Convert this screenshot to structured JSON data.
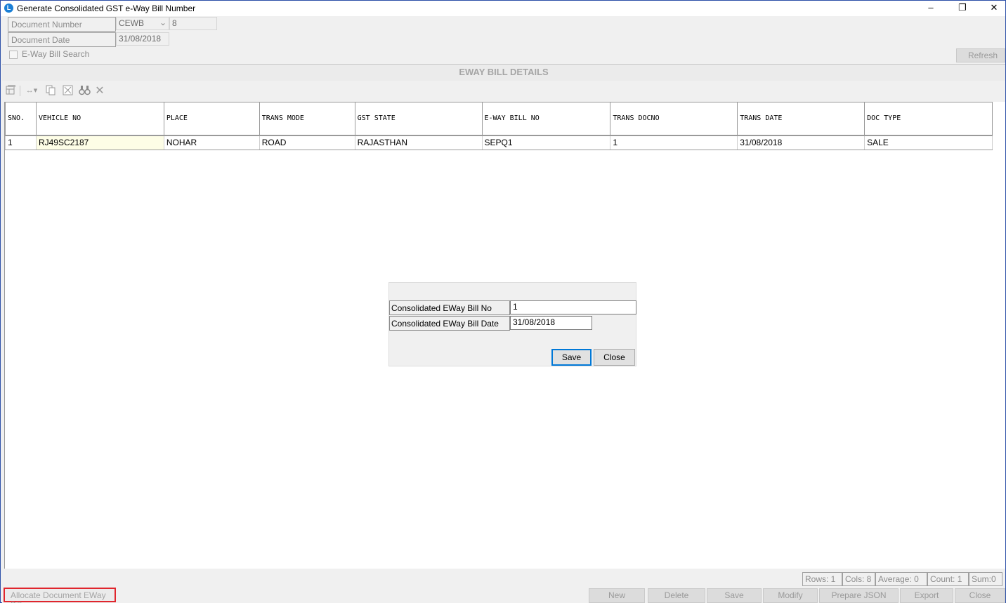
{
  "window": {
    "title": "Generate Consolidated GST e-Way Bill Number",
    "minimize_glyph": "–",
    "restore_glyph": "❐",
    "close_glyph": "✕"
  },
  "header": {
    "doc_number_label": "Document Number",
    "doc_series": "CEWB",
    "doc_number": "8",
    "doc_date_label": "Document Date",
    "doc_date": "31/08/2018",
    "eway_search_label": "E-Way Bill Search",
    "refresh_label": "Refresh"
  },
  "section": {
    "title": "EWAY BILL DETAILS"
  },
  "toolbar": {
    "icons": [
      "grid-settings-icon",
      "column-resize-icon",
      "copy-icon",
      "export-excel-icon",
      "find-icon",
      "clear-icon"
    ]
  },
  "grid": {
    "columns": [
      "SNO.",
      "VEHICLE NO",
      "PLACE",
      "TRANS MODE",
      "GST STATE",
      "E-WAY BILL NO",
      "TRANS DOCNO",
      "TRANS DATE",
      "DOC TYPE"
    ],
    "rows": [
      [
        "1",
        "RJ49SC2187",
        "NOHAR",
        "ROAD",
        "RAJASTHAN",
        "SEPQ1",
        "1",
        "31/08/2018",
        "SALE"
      ]
    ]
  },
  "dialog": {
    "bill_no_label": "Consolidated EWay Bill No",
    "bill_no_value": "1",
    "bill_date_label": "Consolidated EWay Bill Date",
    "bill_date_value": "31/08/2018",
    "save_label": "Save",
    "close_label": "Close"
  },
  "status": {
    "rows": "Rows: 1",
    "cols": "Cols: 8",
    "average": "Average: 0",
    "count": "Count: 1",
    "sum": "Sum:0"
  },
  "bottom": {
    "allocate_label": "Allocate Document EWay Bill",
    "new_label": "New",
    "delete_label": "Delete",
    "save_label": "Save",
    "modify_label": "Modify",
    "prepare_json_label": "Prepare JSON",
    "export_label": "Export",
    "close_label": "Close"
  },
  "colors": {
    "title_border": "#2b4fa8",
    "highlight_border": "#e0262d",
    "active_cell": "#fdfde6",
    "focus_blue": "#0078d7"
  }
}
